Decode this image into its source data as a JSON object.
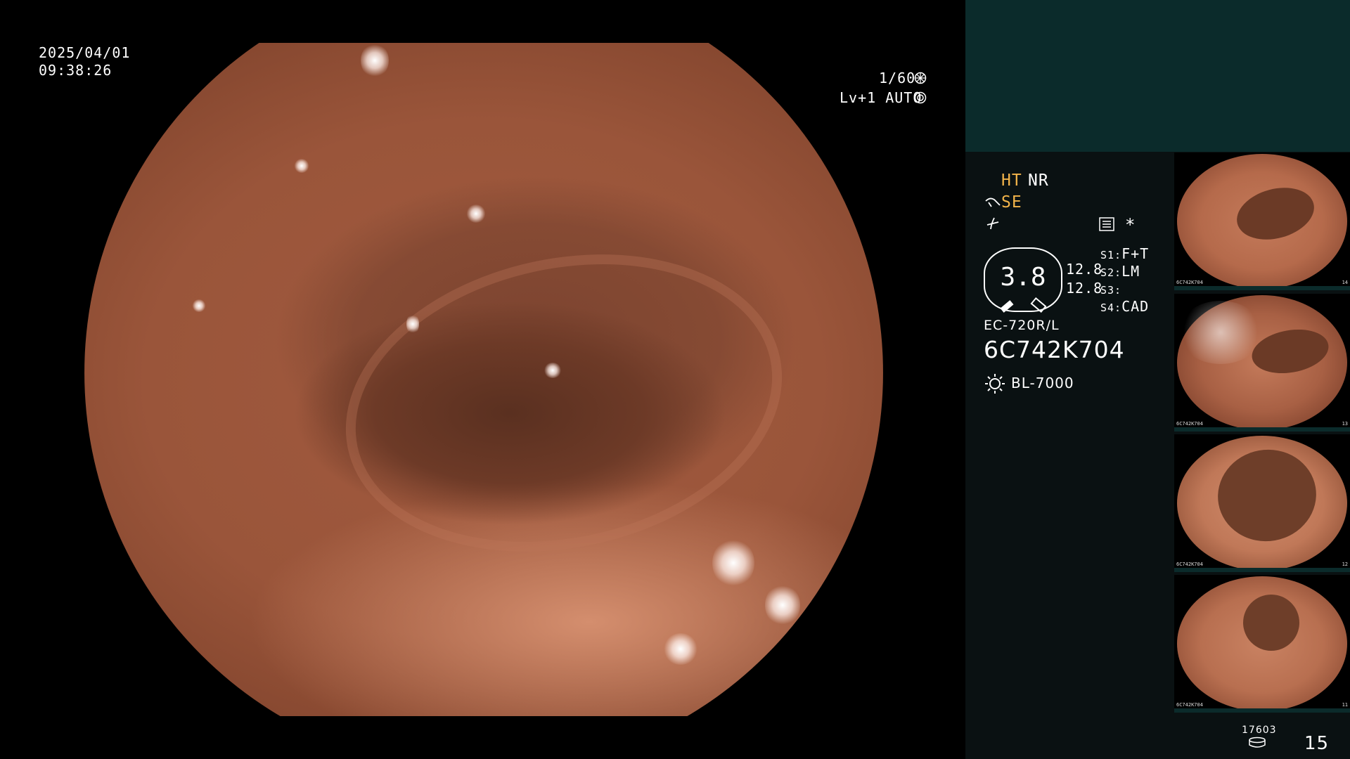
{
  "overlay": {
    "date": "2025/04/01",
    "time": "09:38:26",
    "shutter": "1/60",
    "iris_mode": "Lv+1 AUTO"
  },
  "panel": {
    "mode_ht": "HT",
    "mode_nr": "NR",
    "mode_se": "SE",
    "zoom_value": "3.8",
    "scale_top": "12.8",
    "scale_bottom": "12.8",
    "switches": [
      {
        "key": "S1:",
        "value": "F+T"
      },
      {
        "key": "S2:",
        "value": "LM"
      },
      {
        "key": "S3:",
        "value": ""
      },
      {
        "key": "S4:",
        "value": "CAD"
      }
    ],
    "scope_model": "EC-720R/L",
    "scope_serial": "6C742K704",
    "light_source": "BL-7000",
    "storage_count": "17603",
    "image_count": "15"
  },
  "thumbnails": [
    {
      "serial": "6C742K704",
      "index": "14"
    },
    {
      "serial": "6C742K704",
      "index": "13"
    },
    {
      "serial": "6C742K704",
      "index": "12"
    },
    {
      "serial": "6C742K704",
      "index": "11"
    }
  ],
  "icons": [
    "shutter-icon",
    "iris-icon",
    "pump-icon",
    "settings-icon",
    "asterisk-icon",
    "light-source-icon",
    "storage-icon"
  ],
  "colors": {
    "panel_bg": "#0a1112",
    "top_box": "#0b2b2b",
    "accent_orange": "#f2b44a"
  }
}
